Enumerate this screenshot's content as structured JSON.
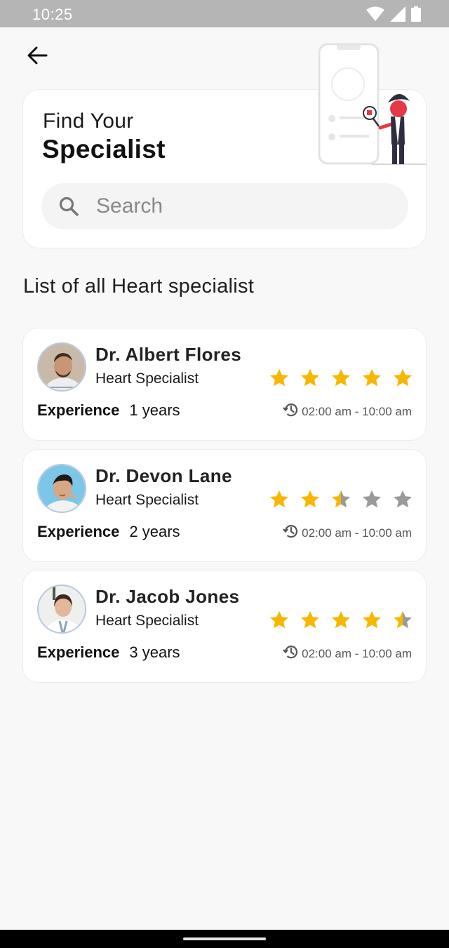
{
  "status_bar": {
    "time": "10:25",
    "icons": [
      "wifi-icon",
      "signal-icon",
      "battery-icon"
    ]
  },
  "header": {
    "back_icon": "arrow-left-icon"
  },
  "hero": {
    "subtitle": "Find Your",
    "title": "Specialist",
    "search_placeholder": "Search",
    "search_icon": "search-icon",
    "illustration": "doctor-phone-illustration"
  },
  "list": {
    "heading": "List of all Heart specialist",
    "doctors": [
      {
        "name": "Dr. Albert Flores",
        "role": "Heart Specialist",
        "rating": 5,
        "experience_label": "Experience",
        "experience_value": "1 years",
        "hours": "02:00 am - 10:00 am"
      },
      {
        "name": "Dr. Devon Lane",
        "role": "Heart Specialist",
        "rating": 2.5,
        "experience_label": "Experience",
        "experience_value": "2 years",
        "hours": "02:00 am - 10:00 am"
      },
      {
        "name": "Dr. Jacob Jones",
        "role": "Heart Specialist",
        "rating": 4.5,
        "experience_label": "Experience",
        "experience_value": "3 years",
        "hours": "02:00 am - 10:00 am"
      }
    ]
  },
  "colors": {
    "star_filled": "#f9b600",
    "star_empty": "#9a9a9a",
    "accent_red": "#e63946"
  }
}
